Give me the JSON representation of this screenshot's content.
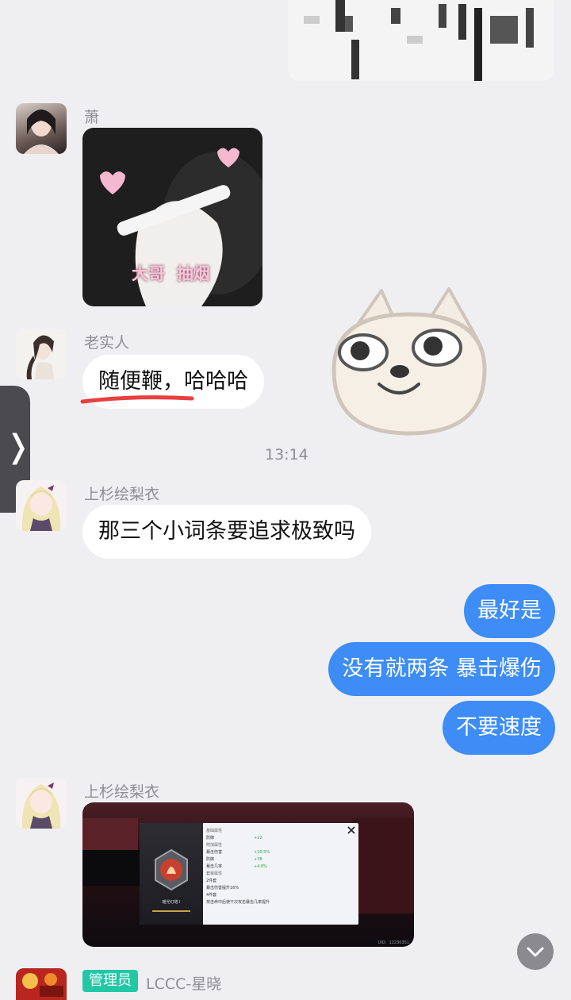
{
  "messages": {
    "top_sticker_alt": "sticker",
    "xiao": {
      "name": "萧",
      "image_caption": "大哥  抽烟"
    },
    "laoshiren": {
      "name": "老实人",
      "text": "随便鞭，哈哈哈"
    },
    "time_divider": "13:14",
    "shangshan_1": {
      "name": "上杉绘梨衣",
      "text": "那三个小词条要追求极致吗"
    },
    "outgoing": [
      {
        "text": "最好是"
      },
      {
        "text": "没有就两条 暴击爆伤"
      },
      {
        "text": "不要速度"
      }
    ],
    "shangshan_2": {
      "name": "上杉绘梨衣",
      "game": {
        "item_name": "瑶光灯塔 I",
        "sections": [
          {
            "title": "基础属性",
            "rows": [
              {
                "label": "防御",
                "value": "+22"
              }
            ]
          },
          {
            "title": "附加属性",
            "rows": [
              {
                "label": "暴击伤害",
                "value": "+10.5%"
              },
              {
                "label": "防御",
                "value": "+78"
              },
              {
                "label": "暴击几率",
                "value": "+4.8%"
              }
            ]
          },
          {
            "title": "套装属性",
            "rows": []
          }
        ],
        "set_2": "2件套",
        "set_2_desc": "暴击伤害提升16%",
        "set_4": "4件套",
        "set_4_desc": "攻击命中后使下次攻击暴击几率提升",
        "uid": "UID：12230351"
      }
    },
    "admin": {
      "badge": "管理员",
      "name": "LCCC-星晓"
    }
  },
  "controls": {
    "side_tab_glyph": "❭",
    "scroll_down_glyph": "⌄"
  },
  "colors": {
    "background": "#efeff1",
    "outgoing_bubble": "#3e8cf5",
    "incoming_bubble": "#ffffff",
    "admin_badge": "#22c7a6",
    "underline_mark": "#e8403f"
  }
}
